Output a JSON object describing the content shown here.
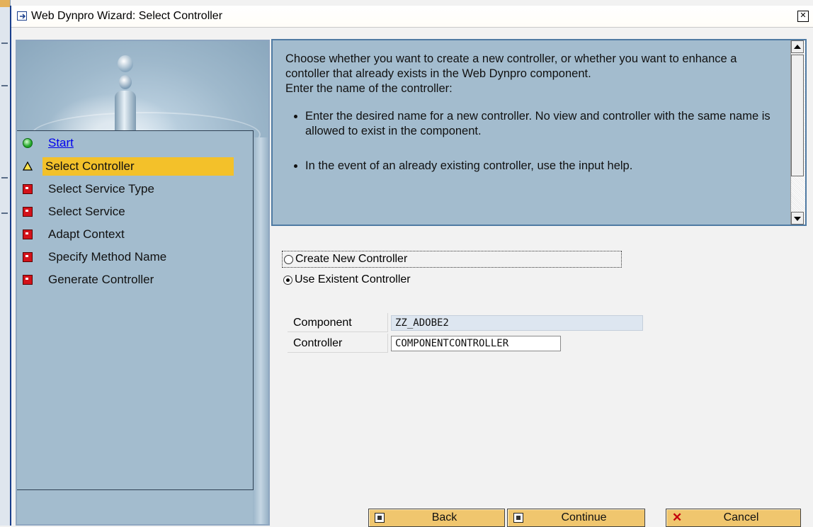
{
  "window": {
    "title": "Web Dynpro Wizard: Select Controller",
    "close_icon": "close-icon"
  },
  "nav": {
    "items": [
      {
        "label": "Start",
        "icon": "green-circle-icon",
        "state": "link"
      },
      {
        "label": "Select Controller",
        "icon": "warning-triangle-icon",
        "state": "active"
      },
      {
        "label": "Select Service Type",
        "icon": "red-square-icon",
        "state": "pending"
      },
      {
        "label": "Select Service",
        "icon": "red-square-icon",
        "state": "pending"
      },
      {
        "label": "Adapt Context",
        "icon": "red-square-icon",
        "state": "pending"
      },
      {
        "label": "Specify Method Name",
        "icon": "red-square-icon",
        "state": "pending"
      },
      {
        "label": "Generate Controller",
        "icon": "red-square-icon",
        "state": "pending"
      }
    ]
  },
  "description": {
    "para1": "Choose whether you want to create a new controller, or whether you want to enhance a contoller that already exists in the Web Dynpro component.",
    "para2": "Enter the name of the controller:",
    "bullets": [
      "Enter the desired name for a new controller. No view and controller with the same name is allowed to exist in the component.",
      "In the event of an already existing controller, use the input help."
    ]
  },
  "options": {
    "create_new": "Create New Controller",
    "use_existent": "Use Existent Controller",
    "selected": "use_existent"
  },
  "form": {
    "component_label": "Component",
    "component_value": "ZZ_ADOBE2",
    "controller_label": "Controller",
    "controller_value": "COMPONENTCONTROLLER"
  },
  "buttons": {
    "back": "Back",
    "continue": "Continue",
    "cancel": "Cancel"
  },
  "colors": {
    "active_highlight": "#f3c12a",
    "panel_bg": "#a3bcce",
    "button_bg": "#f0c66e",
    "title_border": "#1a3f8c"
  }
}
